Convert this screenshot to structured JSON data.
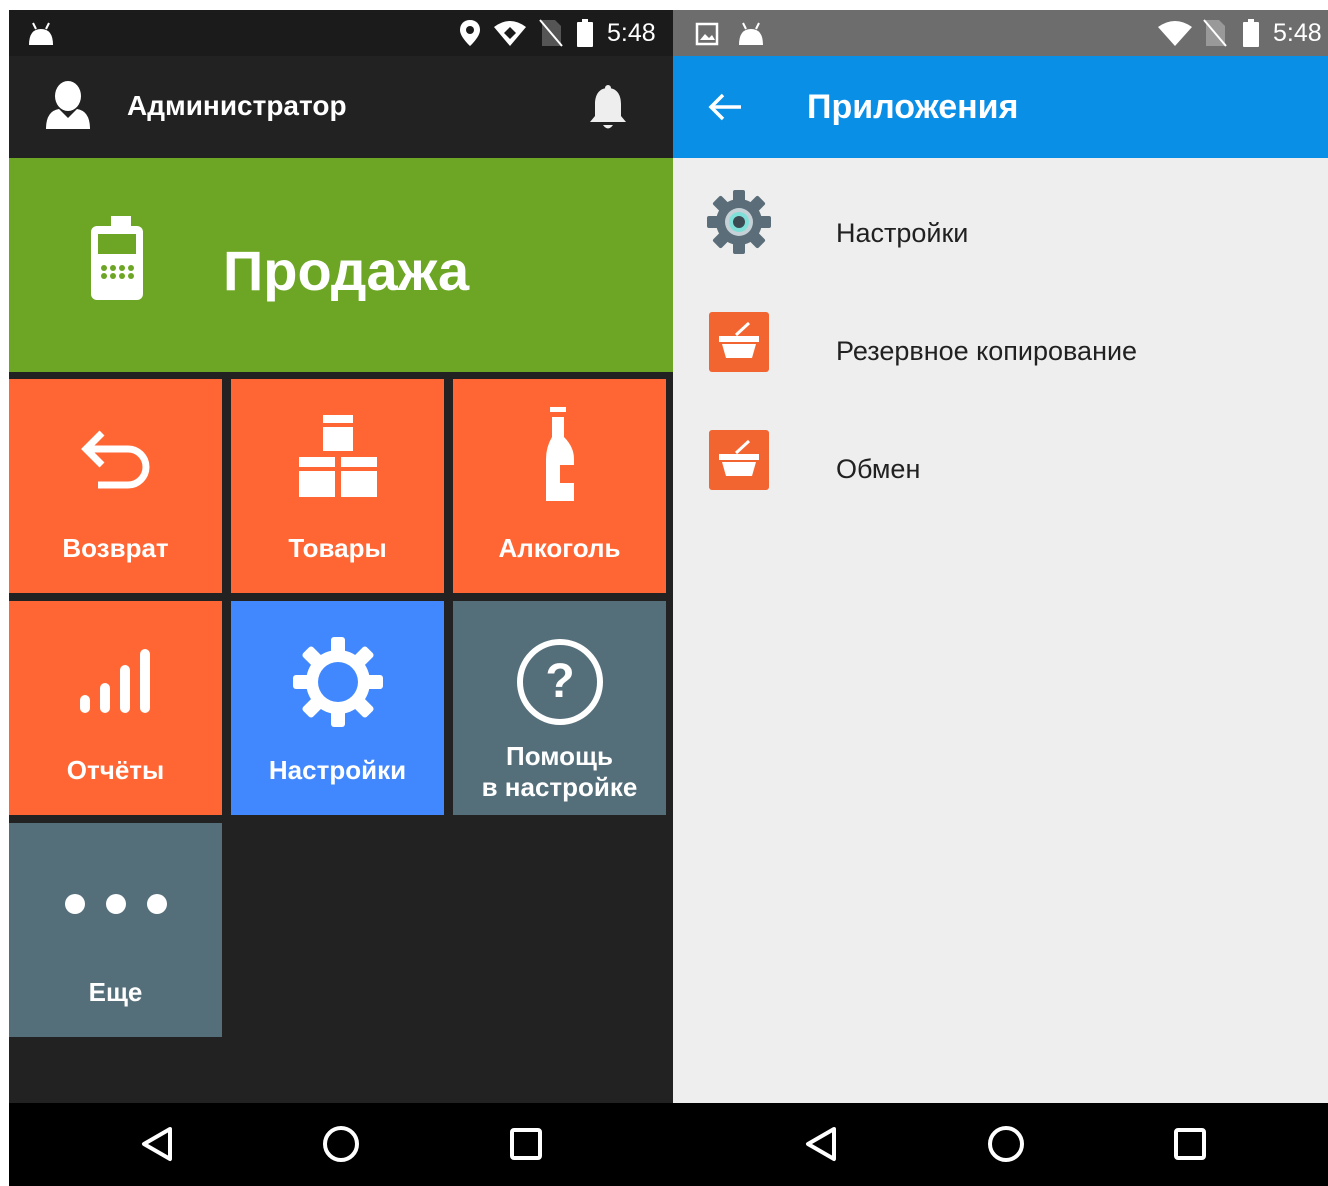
{
  "left_screen": {
    "status_bar": {
      "time": "5:48",
      "icons": [
        "android-icon",
        "location-icon",
        "wifi-icon",
        "no-sim-icon",
        "battery-icon"
      ]
    },
    "header": {
      "user_name": "Администратор",
      "icons": [
        "user-avatar-icon",
        "bell-icon"
      ]
    },
    "sale_tile": {
      "label": "Продажа",
      "icon": "cash-register-icon",
      "color": "#6ca624"
    },
    "tiles": [
      {
        "label": "Возврат",
        "icon": "return-arrow-icon",
        "color": "#ff6633"
      },
      {
        "label": "Товары",
        "icon": "boxes-icon",
        "color": "#ff6633"
      },
      {
        "label": "Алкоголь",
        "icon": "bottle-icon",
        "color": "#ff6633"
      },
      {
        "label": "Отчёты",
        "icon": "bar-chart-icon",
        "color": "#ff6633"
      },
      {
        "label": "Настройки",
        "icon": "gear-icon",
        "color": "#4188ff"
      },
      {
        "label_line1": "Помощь",
        "label_line2": "в настройке",
        "icon": "help-circle-icon",
        "color": "#546e7a"
      },
      {
        "label": "Еще",
        "icon": "more-dots-icon",
        "color": "#546e7a"
      }
    ],
    "nav_bar": [
      "back-icon",
      "home-icon",
      "recents-icon"
    ]
  },
  "right_screen": {
    "status_bar": {
      "time": "5:48",
      "icons": [
        "image-notification-icon",
        "android-icon",
        "wifi-icon",
        "no-sim-icon",
        "battery-icon"
      ]
    },
    "app_bar": {
      "title": "Приложения",
      "color": "#0a8fe6",
      "back_icon": "arrow-back-icon"
    },
    "apps": [
      {
        "label": "Настройки",
        "icon": "settings-gear-icon"
      },
      {
        "label": "Резервное копирование",
        "icon": "basket-icon"
      },
      {
        "label": "Обмен",
        "icon": "basket-icon"
      }
    ],
    "nav_bar": [
      "back-icon",
      "home-icon",
      "recents-icon"
    ]
  }
}
